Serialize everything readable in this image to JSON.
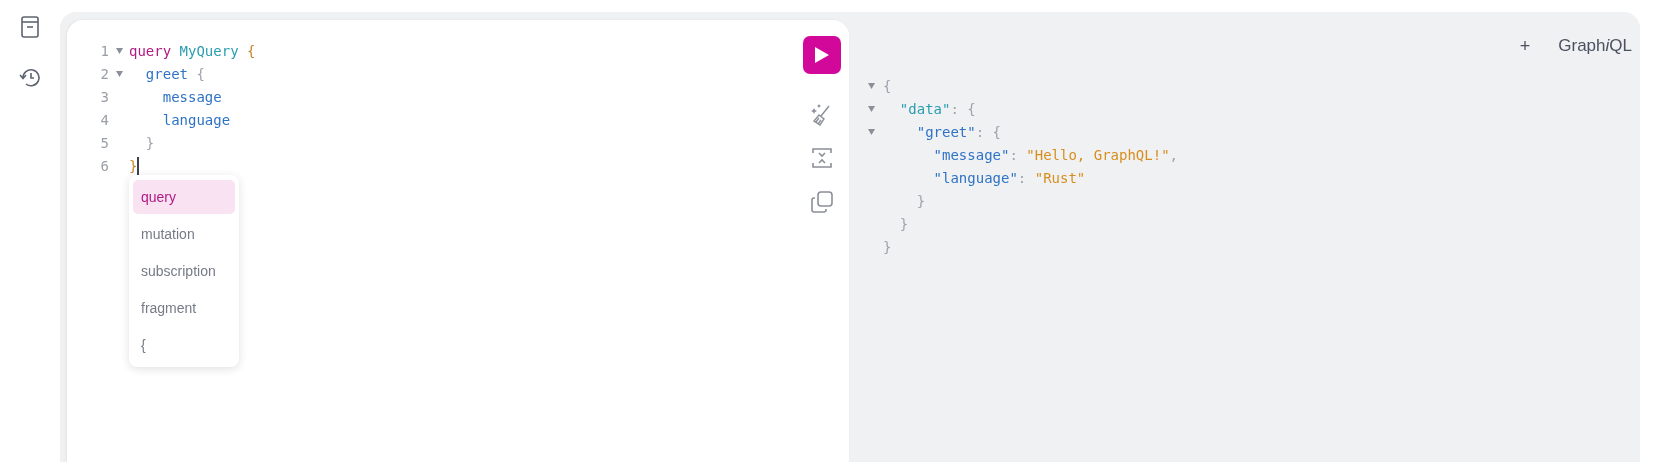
{
  "editor": {
    "lines": [
      {
        "number": "1",
        "foldable": true,
        "cursor": false,
        "tokens": [
          {
            "text": "query ",
            "kind": "keyword"
          },
          {
            "text": "MyQuery ",
            "kind": "def"
          },
          {
            "text": "{",
            "kind": "brace"
          }
        ]
      },
      {
        "number": "2",
        "foldable": true,
        "cursor": false,
        "tokens": [
          {
            "text": "  greet ",
            "kind": "field"
          },
          {
            "text": "{",
            "kind": "punct"
          }
        ]
      },
      {
        "number": "3",
        "foldable": false,
        "cursor": false,
        "tokens": [
          {
            "text": "    message",
            "kind": "field"
          }
        ]
      },
      {
        "number": "4",
        "foldable": false,
        "cursor": false,
        "tokens": [
          {
            "text": "    language",
            "kind": "field"
          }
        ]
      },
      {
        "number": "5",
        "foldable": false,
        "cursor": false,
        "tokens": [
          {
            "text": "  }",
            "kind": "punct"
          }
        ]
      },
      {
        "number": "6",
        "foldable": false,
        "cursor": true,
        "tokens": [
          {
            "text": "}",
            "kind": "brace"
          }
        ]
      }
    ]
  },
  "autocomplete": [
    {
      "label": "query",
      "selected": true
    },
    {
      "label": "mutation",
      "selected": false
    },
    {
      "label": "subscription",
      "selected": false
    },
    {
      "label": "fragment",
      "selected": false
    },
    {
      "label": "{",
      "selected": false
    }
  ],
  "header": {
    "new_tab": "+",
    "logo": [
      {
        "text": "Graph",
        "italic": false
      },
      {
        "text": "i",
        "italic": true
      },
      {
        "text": "QL",
        "italic": false
      }
    ]
  },
  "response": {
    "lines": [
      {
        "foldable": true,
        "tokens": [
          {
            "text": "{",
            "kind": "punct"
          }
        ]
      },
      {
        "foldable": true,
        "tokens": [
          {
            "text": "  \"data\"",
            "kind": "def"
          },
          {
            "text": ": {",
            "kind": "punct"
          }
        ]
      },
      {
        "foldable": true,
        "tokens": [
          {
            "text": "    \"greet\"",
            "kind": "field"
          },
          {
            "text": ": {",
            "kind": "punct"
          }
        ]
      },
      {
        "foldable": false,
        "tokens": [
          {
            "text": "      \"message\"",
            "kind": "field"
          },
          {
            "text": ": ",
            "kind": "punct"
          },
          {
            "text": "\"Hello, GraphQL!\"",
            "kind": "string"
          },
          {
            "text": ",",
            "kind": "punct"
          }
        ]
      },
      {
        "foldable": false,
        "tokens": [
          {
            "text": "      \"language\"",
            "kind": "field"
          },
          {
            "text": ": ",
            "kind": "punct"
          },
          {
            "text": "\"Rust\"",
            "kind": "string"
          }
        ]
      },
      {
        "foldable": false,
        "tokens": [
          {
            "text": "    }",
            "kind": "punct"
          }
        ]
      },
      {
        "foldable": false,
        "tokens": [
          {
            "text": "  }",
            "kind": "punct"
          }
        ]
      },
      {
        "foldable": false,
        "tokens": [
          {
            "text": "}",
            "kind": "punct"
          }
        ]
      }
    ]
  }
}
